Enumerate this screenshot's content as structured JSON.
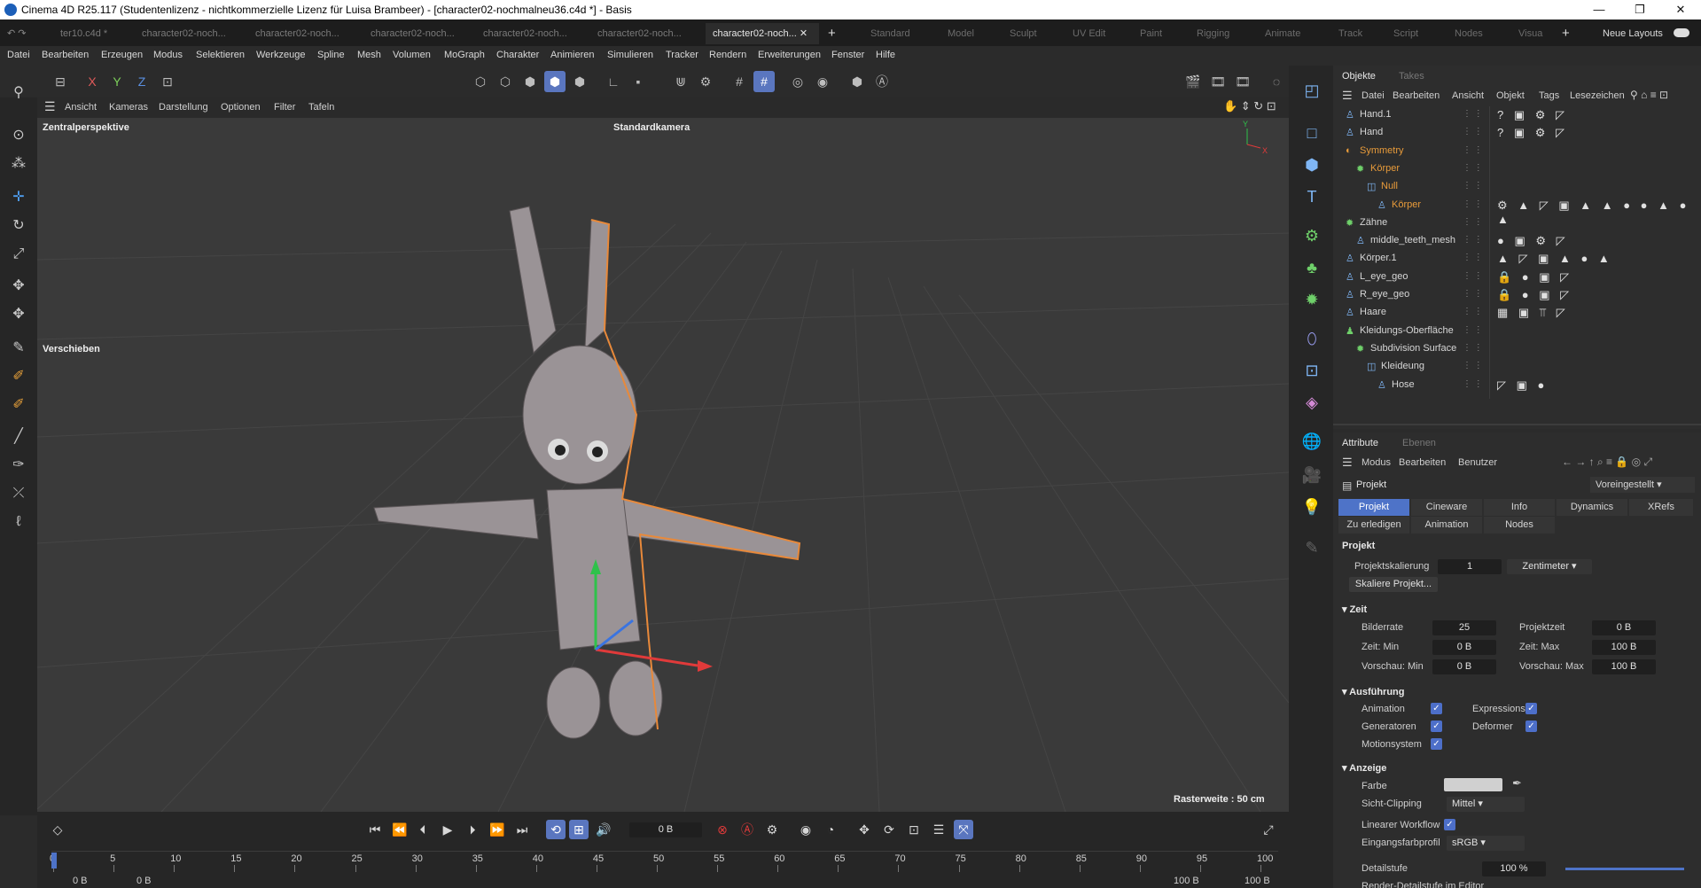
{
  "window": {
    "title": "Cinema 4D R25.117 (Studentenlizenz - nichtkommerzielle Lizenz für Luisa Brambeer) - [character02-nochmalneu36.c4d *] - Basis",
    "min": "—",
    "max": "❐",
    "close": "✕"
  },
  "tabs": [
    "ter10.c4d *",
    "character02-noch...",
    "character02-noch...",
    "character02-noch...",
    "character02-noch...",
    "character02-noch...",
    "character02-noch..."
  ],
  "tab_add": "+",
  "layouts": [
    "Standard",
    "Model",
    "Sculpt",
    "UV Edit",
    "Paint",
    "Rigging",
    "Animate",
    "Track",
    "Script",
    "Nodes",
    "Visua"
  ],
  "neue_layouts": "Neue Layouts",
  "menu": [
    "Datei",
    "Bearbeiten",
    "Erzeugen",
    "Modus",
    "Selektieren",
    "Werkzeuge",
    "Spline",
    "Mesh",
    "Volumen",
    "MoGraph",
    "Charakter",
    "Animieren",
    "Simulieren",
    "Tracker",
    "Rendern",
    "Erweiterungen",
    "Fenster",
    "Hilfe"
  ],
  "axis_labels": [
    "X",
    "Y",
    "Z"
  ],
  "viewport": {
    "menu": [
      "Ansicht",
      "Kameras",
      "Darstellung",
      "Optionen",
      "Filter",
      "Tafeln"
    ],
    "perspective": "Zentralperspektive",
    "camera": "Standardkamera",
    "tool": "Verschieben",
    "grid": "Rasterweite : 50 cm"
  },
  "object_panel": {
    "tabs": [
      "Objekte",
      "Takes"
    ],
    "menu": [
      "Datei",
      "Bearbeiten",
      "Ansicht",
      "Objekt",
      "Tags",
      "Lesezeichen"
    ],
    "rows": [
      {
        "name": "Hand.1",
        "indent": 0,
        "color": "#d6d6d6",
        "icon": "bone",
        "tags": "? ▣ ⚙ ◸"
      },
      {
        "name": "Hand",
        "indent": 0,
        "color": "#d6d6d6",
        "icon": "bone",
        "tags": "? ▣ ⚙ ◸"
      },
      {
        "name": "Symmetry",
        "indent": 0,
        "color": "#e89b3a",
        "icon": "symmetry",
        "tags": ""
      },
      {
        "name": "Körper",
        "indent": 1,
        "color": "#e89b3a",
        "icon": "gear",
        "tags": ""
      },
      {
        "name": "Null",
        "indent": 2,
        "color": "#e89b3a",
        "icon": "null",
        "tags": ""
      },
      {
        "name": "Körper",
        "indent": 3,
        "color": "#e89b3a",
        "icon": "mesh",
        "tags": "⚙ ▲ ◸ ▣ ▲ ▲ ● ● ▲ ● ▲"
      },
      {
        "name": "Zähne",
        "indent": 0,
        "color": "#d6d6d6",
        "icon": "gear",
        "tags": ""
      },
      {
        "name": "middle_teeth_mesh",
        "indent": 1,
        "color": "#d6d6d6",
        "icon": "mesh",
        "tags": "● ▣ ⚙ ◸"
      },
      {
        "name": "Körper.1",
        "indent": 0,
        "color": "#d6d6d6",
        "icon": "bone",
        "tags": "▲ ◸ ▣ ▲ ● ▲"
      },
      {
        "name": "L_eye_geo",
        "indent": 0,
        "color": "#d6d6d6",
        "icon": "bone",
        "tags": "🔒 ● ▣ ◸"
      },
      {
        "name": "R_eye_geo",
        "indent": 0,
        "color": "#d6d6d6",
        "icon": "bone",
        "tags": "🔒 ● ▣ ◸"
      },
      {
        "name": "Haare",
        "indent": 0,
        "color": "#d6d6d6",
        "icon": "bone",
        "tags": "▦ ▣ ⫪ ◸"
      },
      {
        "name": "Kleidungs-Oberfläche",
        "indent": 0,
        "color": "#d6d6d6",
        "icon": "cloth",
        "tags": ""
      },
      {
        "name": "Subdivision Surface",
        "indent": 1,
        "color": "#d6d6d6",
        "icon": "gear",
        "tags": ""
      },
      {
        "name": "Kleideung",
        "indent": 2,
        "color": "#d6d6d6",
        "icon": "null",
        "tags": ""
      },
      {
        "name": "Hose",
        "indent": 3,
        "color": "#d6d6d6",
        "icon": "mesh",
        "tags": "◸ ▣ ●"
      }
    ]
  },
  "attributes": {
    "tabs": [
      "Attribute",
      "Ebenen"
    ],
    "menu": [
      "Modus",
      "Bearbeiten",
      "Benutzer"
    ],
    "object": "Projekt",
    "preset": "Voreingestellt",
    "ptabs": [
      "Projekt",
      "Cineware",
      "Info",
      "Dynamics",
      "XRefs"
    ],
    "ptabs2": [
      "Zu erledigen",
      "Animation",
      "Nodes"
    ],
    "section": "Projekt",
    "scale_label": "Projektskalierung",
    "scale_value": "1",
    "scale_unit": "Zentimeter",
    "scale_btn": "Skaliere Projekt...",
    "zeit": "Zeit",
    "bilderrate_l": "Bilderrate",
    "bilderrate": "25",
    "projektzeit_l": "Projektzeit",
    "projektzeit": "0 B",
    "zeitmin_l": "Zeit: Min",
    "zeitmin": "0 B",
    "zeitmax_l": "Zeit: Max",
    "zeitmax": "100 B",
    "vormin_l": "Vorschau: Min",
    "vormin": "0 B",
    "vormax_l": "Vorschau: Max",
    "vormax": "100 B",
    "ausfuehrung": "Ausführung",
    "animation": "Animation",
    "expressions": "Expressions",
    "generatoren": "Generatoren",
    "deformer": "Deformer",
    "motionsystem": "Motionsystem",
    "anzeige": "Anzeige",
    "farbe": "Farbe",
    "sichtclip": "Sicht-Clipping",
    "sichtclip_v": "Mittel",
    "linwf": "Linearer Workflow",
    "eingang": "Eingangsfarbprofil",
    "eingang_v": "sRGB",
    "detail": "Detailstufe",
    "detail_v": "100 %",
    "render_detail": "Render-Detailstufe im Editor"
  },
  "timeline": {
    "frame": "0 B",
    "ticks": [
      "0",
      "5",
      "10",
      "15",
      "20",
      "25",
      "30",
      "35",
      "40",
      "45",
      "50",
      "55",
      "60",
      "65",
      "70",
      "75",
      "80",
      "85",
      "90",
      "95",
      "100"
    ],
    "start": "0 B",
    "startb": "0 B",
    "end": "100 B",
    "endb": "100 B"
  },
  "colors": {
    "accent": "#5a76bf",
    "selection_orange": "#e89b3a"
  }
}
